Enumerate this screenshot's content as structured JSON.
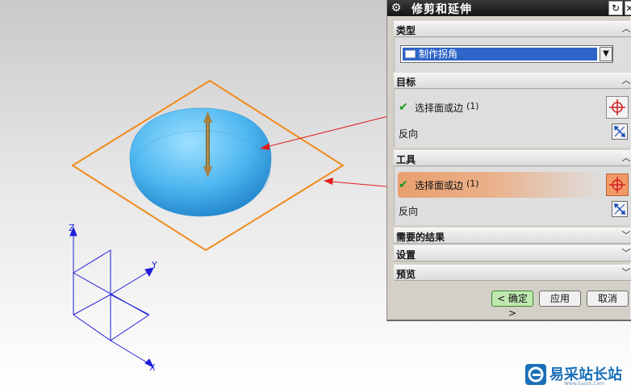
{
  "dialog": {
    "title": "修剪和延伸",
    "title_icon": "gear-icon",
    "close_label": "×"
  },
  "sections": {
    "type": {
      "label": "类型",
      "dropdown_value": "制作拐角",
      "dropdown_icon": "corner-type-icon"
    },
    "target": {
      "label": "目标",
      "select_label": "选择面或边",
      "select_count": "(1)",
      "reverse_label": "反向"
    },
    "tool": {
      "label": "工具",
      "select_label": "选择面或边",
      "select_count": "(1)",
      "reverse_label": "反向"
    },
    "required_results": {
      "label": "需要的结果"
    },
    "settings": {
      "label": "设置"
    },
    "preview": {
      "label": "预览"
    }
  },
  "buttons": {
    "ok": "< 确定 >",
    "apply": "应用",
    "cancel": "取消"
  },
  "viewport": {
    "axis_labels": {
      "x": "X",
      "y": "Y",
      "z": "Z"
    },
    "plane_color": "#f08a1c",
    "body_color": "#4fb8f0",
    "arrow_color": "#9a7a40",
    "annotation_color": "#e02020"
  },
  "watermark": {
    "brand": "易采站长站",
    "url": "Www.Easck.Com"
  },
  "colors": {
    "check": "#1a9a1a",
    "highlight": "#e9a070",
    "dropdown_selected": "#2f64c8"
  }
}
